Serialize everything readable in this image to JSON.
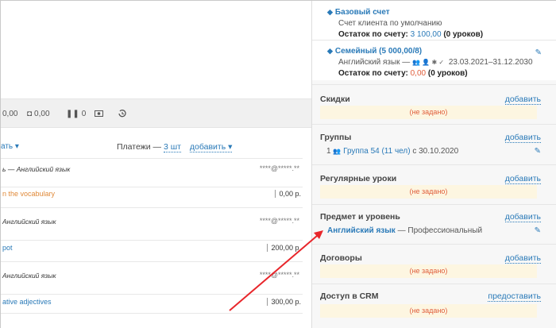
{
  "toolbar": {
    "item1": "0,00",
    "item2": "0,00",
    "item3": "0",
    "item4": "",
    "item5": ""
  },
  "payments": {
    "caret_link": "ать ▾",
    "label": "Платежи —",
    "count": "3 шт",
    "add": "добавить ▾"
  },
  "rows": [
    {
      "title": "ь — Английский язык",
      "stars": "****@*****.**",
      "topic": "n the vocabulary",
      "price": "0,00 р.",
      "topic_color": "#e08a3a"
    },
    {
      "title": "Английский язык",
      "stars": "****@*****.**",
      "topic": "pot",
      "price": "200,00 р.",
      "topic_color": "#2a7ab8"
    },
    {
      "title": "Английский язык",
      "stars": "****@*****.**",
      "topic": "ative adjectives",
      "price": "300,00 р.",
      "topic_color": "#2a7ab8"
    }
  ],
  "accounts": {
    "base": {
      "title": "Базовый счет",
      "subtitle": "Счет клиента по умолчанию",
      "balance_label": "Остаток по счету:",
      "balance_value": "3 100,00",
      "balance_lessons": "(0 уроков)"
    },
    "family": {
      "title": "Семейный (5 000,00/8)",
      "subtitle": "Английский язык —",
      "icons": "👥 👤 ✱ ✓",
      "dates": "23.03.2021–31.12.2030",
      "balance_label": "Остаток по счету:",
      "balance_value": "0,00",
      "balance_lessons": "(0 уроков)"
    }
  },
  "sections": {
    "discounts": {
      "title": "Скидки",
      "link": "добавить",
      "empty": "(не задано)"
    },
    "groups": {
      "title": "Группы",
      "link": "добавить",
      "count": "1",
      "group_name": "Группа 54 (11 чел)",
      "since": "с 30.10.2020"
    },
    "regular": {
      "title": "Регулярные уроки",
      "link": "добавить",
      "empty": "(не задано)"
    },
    "subject": {
      "title": "Предмет и уровень",
      "link": "добавить",
      "subject_name": "Английский язык",
      "level": "— Профессиональный"
    },
    "contracts": {
      "title": "Договоры",
      "link": "добавить",
      "empty": "(не задано)"
    },
    "crm": {
      "title": "Доступ в CRM",
      "link": "предоставить",
      "empty": "(не задано)"
    }
  },
  "colors": {
    "accent": "#2a7ab8",
    "warn": "#e05d3a",
    "arrow": "#e8262b",
    "empty_bg": "#fdf6e1"
  }
}
